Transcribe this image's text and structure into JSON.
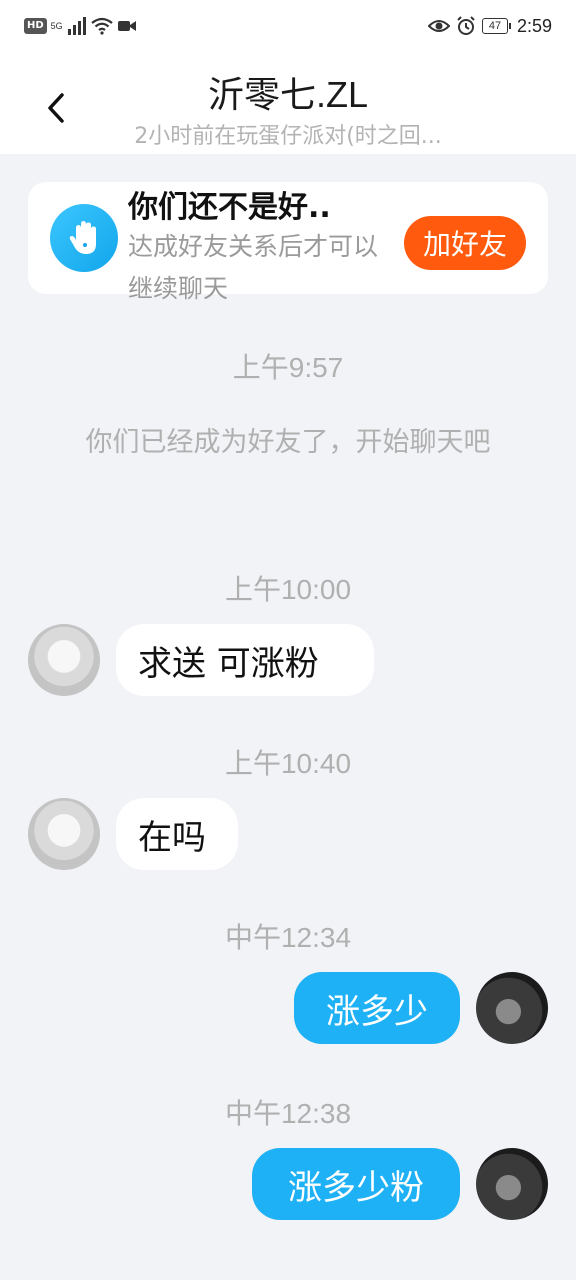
{
  "status_bar": {
    "left_badges": [
      "HD",
      "5G"
    ],
    "battery_level": "47",
    "time": "2:59"
  },
  "header": {
    "title": "沂零七.ZL",
    "subtitle": "2小时前在玩蛋仔派对(时之回..."
  },
  "friend_card": {
    "title": "你们还不是好..",
    "description": "达成好友关系后才可以继续聊天",
    "add_button": "加好友"
  },
  "messages": [
    {
      "type": "timestamp",
      "text": "上午9:57"
    },
    {
      "type": "system",
      "text": "你们已经成为好友了，开始聊天吧"
    },
    {
      "type": "timestamp",
      "text": "上午10:00"
    },
    {
      "type": "incoming",
      "text": "求送 可涨粉"
    },
    {
      "type": "timestamp",
      "text": "上午10:40"
    },
    {
      "type": "incoming",
      "text": "在吗"
    },
    {
      "type": "timestamp",
      "text": "中午12:34"
    },
    {
      "type": "outgoing",
      "text": "涨多少"
    },
    {
      "type": "timestamp",
      "text": "中午12:38"
    },
    {
      "type": "outgoing",
      "text": "涨多少粉"
    }
  ],
  "colors": {
    "accent_blue": "#1fb1f5",
    "add_button": "#ff5a0e",
    "background": "#f2f3f7"
  }
}
